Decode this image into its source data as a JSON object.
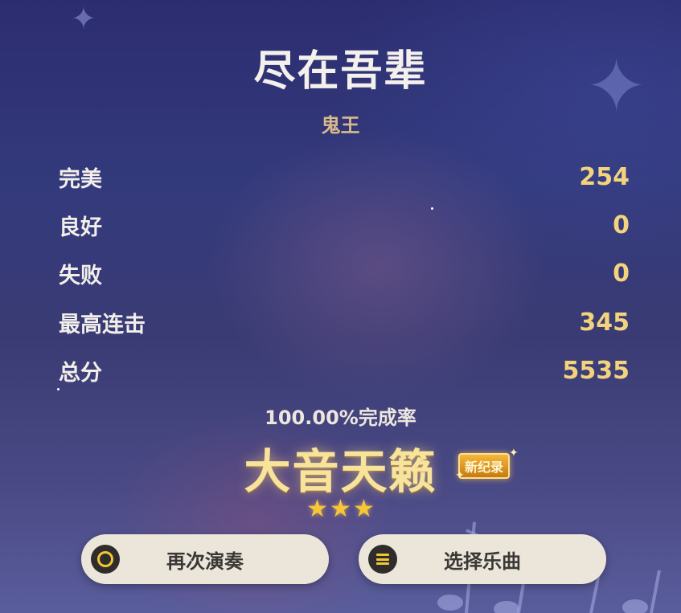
{
  "song": {
    "title": "尽在吾辈",
    "artist": "鬼王"
  },
  "stats": [
    {
      "label": "完美",
      "value": "254"
    },
    {
      "label": "良好",
      "value": "0"
    },
    {
      "label": "失败",
      "value": "0"
    },
    {
      "label": "最高连击",
      "value": "345"
    },
    {
      "label": "总分",
      "value": "5535"
    }
  ],
  "result": {
    "completion": "100.00%完成率",
    "rank": "大音天籁",
    "badge": "新纪录",
    "stars_earned": 3,
    "stars_total": 3
  },
  "buttons": {
    "replay": {
      "label": "再次演奏",
      "icon": "circle-icon"
    },
    "select": {
      "label": "选择乐曲",
      "icon": "menu-icon"
    }
  },
  "colors": {
    "value_gold": "#f3d47c",
    "rank_gold": "#f8e39a",
    "button_bg": "#ece6da",
    "star": "#f6c636"
  }
}
